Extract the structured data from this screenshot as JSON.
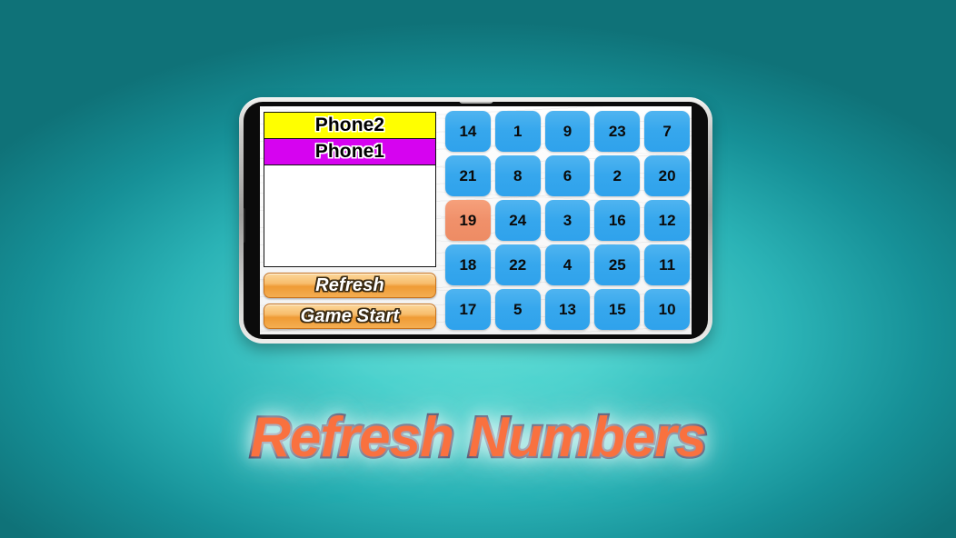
{
  "background": {
    "center_color": "#4fd2ce",
    "edge_color": "#0f7278"
  },
  "device": {
    "frame_color": "#9e9e9c",
    "bezel_color": "#0b0b0b"
  },
  "app": {
    "left_panel": {
      "player_bands": [
        {
          "label": "Phone2",
          "color": "#ffff00"
        },
        {
          "label": "Phone1",
          "color": "#d603f0"
        }
      ],
      "message_panel_text": "",
      "buttons": [
        {
          "label": "Refresh"
        },
        {
          "label": "Game Start"
        }
      ]
    },
    "grid": {
      "columns": 5,
      "rows": 5,
      "tile_color": "#36a7ed",
      "selected_tile_color": "#f0906a",
      "tiles": [
        {
          "value": "14",
          "state": "normal"
        },
        {
          "value": "1",
          "state": "normal"
        },
        {
          "value": "9",
          "state": "normal"
        },
        {
          "value": "23",
          "state": "normal"
        },
        {
          "value": "7",
          "state": "normal"
        },
        {
          "value": "21",
          "state": "normal"
        },
        {
          "value": "8",
          "state": "normal"
        },
        {
          "value": "6",
          "state": "normal"
        },
        {
          "value": "2",
          "state": "normal"
        },
        {
          "value": "20",
          "state": "normal"
        },
        {
          "value": "19",
          "state": "selected"
        },
        {
          "value": "24",
          "state": "normal"
        },
        {
          "value": "3",
          "state": "normal"
        },
        {
          "value": "16",
          "state": "normal"
        },
        {
          "value": "12",
          "state": "normal"
        },
        {
          "value": "18",
          "state": "normal"
        },
        {
          "value": "22",
          "state": "normal"
        },
        {
          "value": "4",
          "state": "normal"
        },
        {
          "value": "25",
          "state": "normal"
        },
        {
          "value": "11",
          "state": "normal"
        },
        {
          "value": "17",
          "state": "normal"
        },
        {
          "value": "5",
          "state": "normal"
        },
        {
          "value": "13",
          "state": "normal"
        },
        {
          "value": "15",
          "state": "normal"
        },
        {
          "value": "10",
          "state": "normal"
        }
      ]
    }
  },
  "caption": {
    "title": "Refresh Numbers",
    "fill_color": "#f9713f",
    "outline_color": "#231942"
  }
}
